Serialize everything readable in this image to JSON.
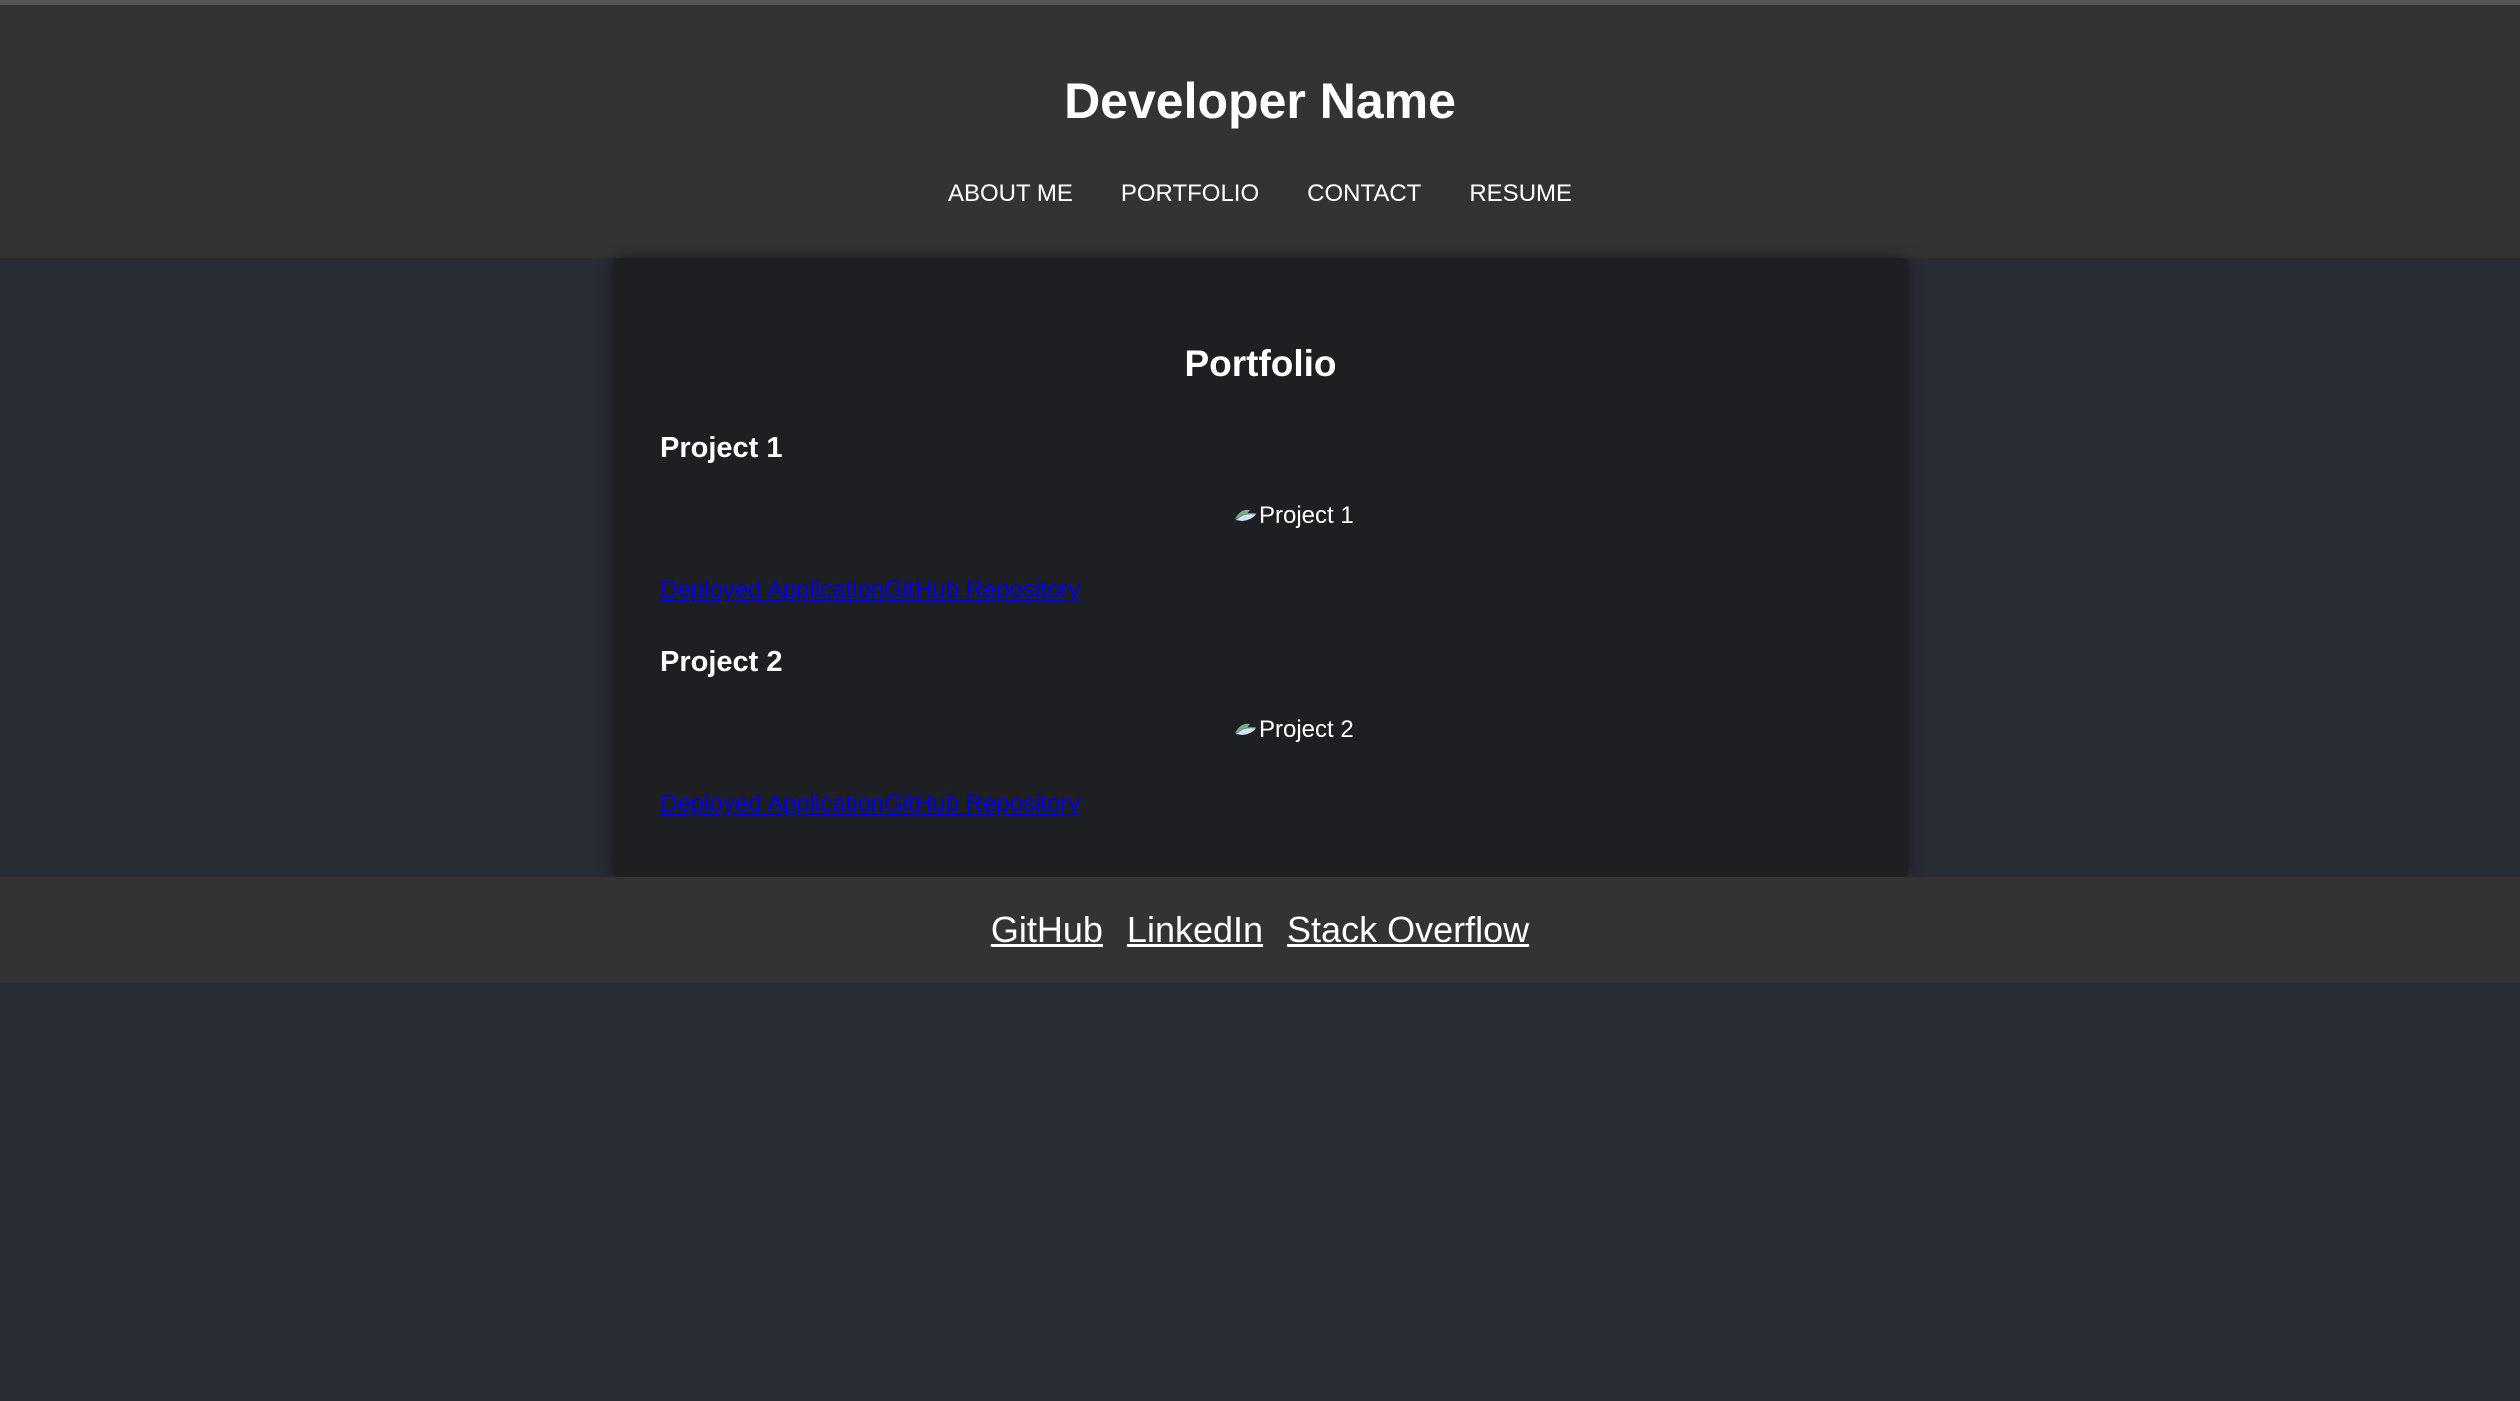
{
  "header": {
    "title": "Developer Name",
    "nav": [
      {
        "label": "ABOUT ME"
      },
      {
        "label": "PORTFOLIO"
      },
      {
        "label": "CONTACT"
      },
      {
        "label": "RESUME"
      }
    ]
  },
  "main": {
    "heading": "Portfolio",
    "projects": [
      {
        "title": "Project 1",
        "image_alt": "Project 1",
        "deployed_label": "Deployed Application",
        "repo_label": "GitHub Repository"
      },
      {
        "title": "Project 2",
        "image_alt": "Project 2",
        "deployed_label": "Deployed Application",
        "repo_label": "GitHub Repository"
      }
    ]
  },
  "footer": {
    "links": [
      {
        "label": "GitHub"
      },
      {
        "label": "LinkedIn"
      },
      {
        "label": "Stack Overflow"
      }
    ]
  },
  "colors": {
    "page_background": "#282c34",
    "header_background": "#333333",
    "card_background": "#1e1f23",
    "link_color": "#0000ee",
    "text_color": "#ffffff"
  },
  "icons": {
    "broken_image": "broken-image-icon"
  }
}
